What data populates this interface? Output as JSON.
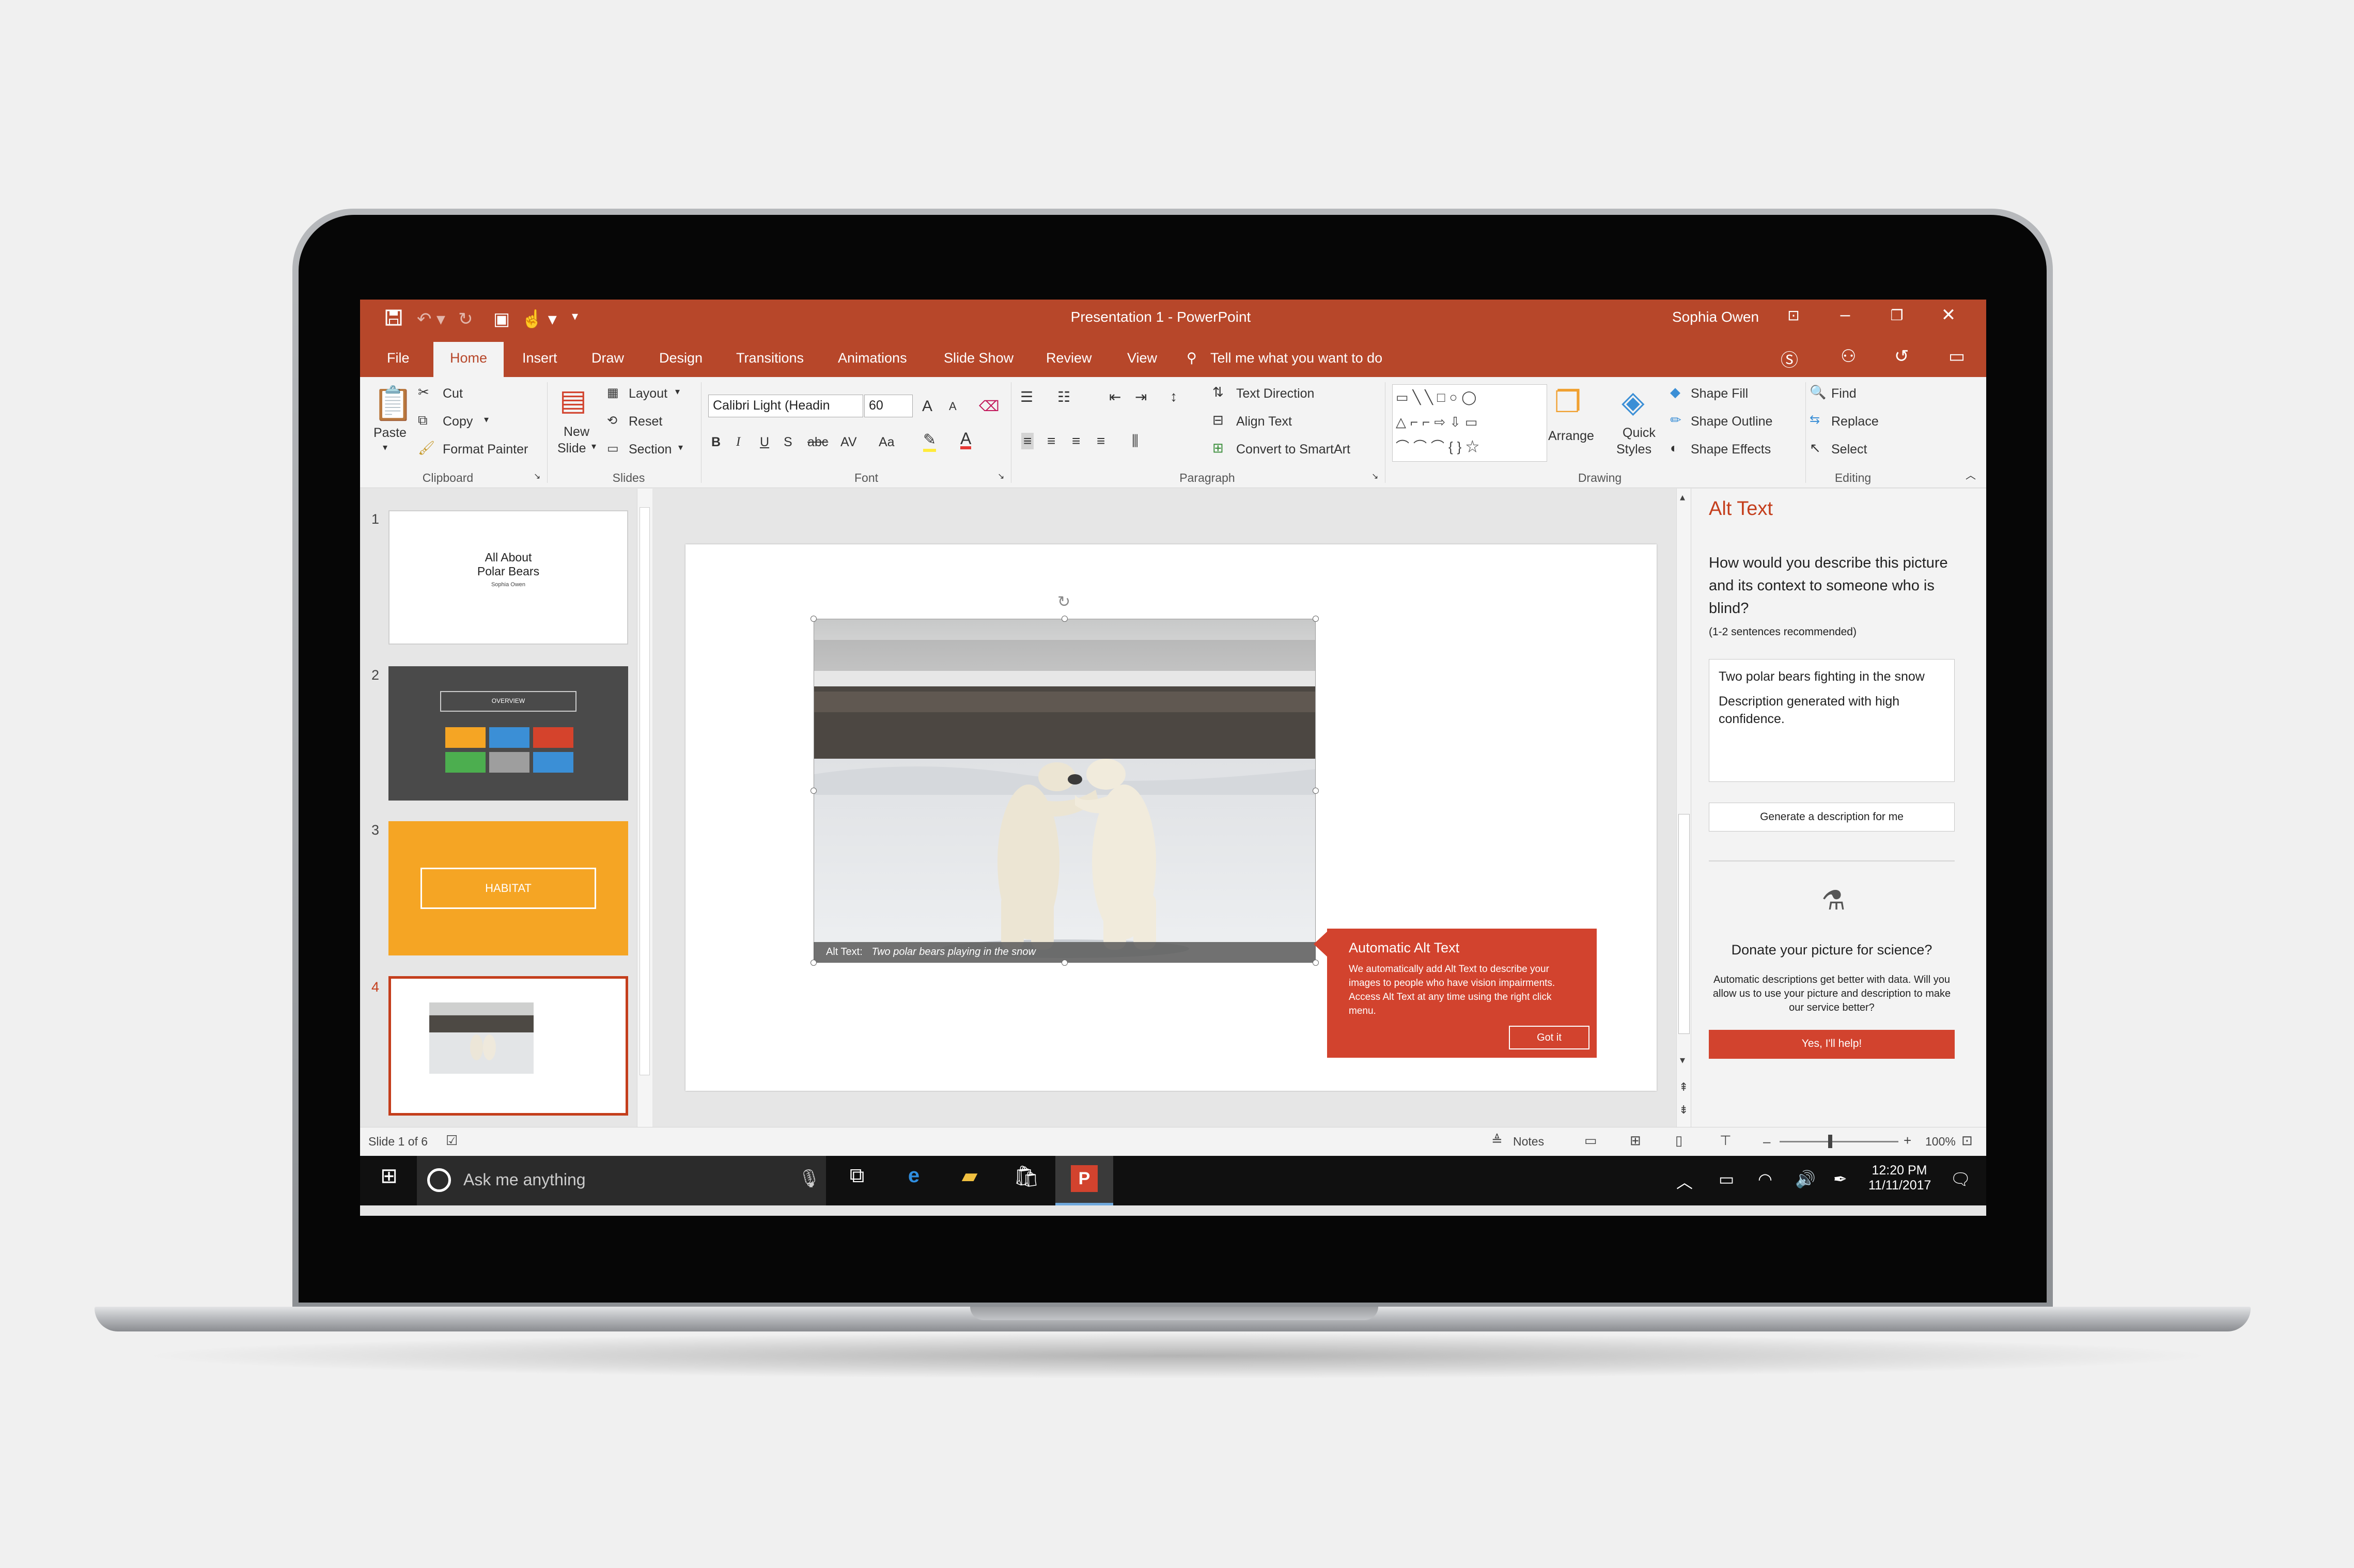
{
  "window": {
    "title": "Presentation 1 - PowerPoint",
    "user": "Sophia Owen"
  },
  "qat": {
    "save_icon": "save-icon",
    "undo_icon": "undo-icon",
    "redo_icon": "redo-icon",
    "present_icon": "present-icon",
    "touch_icon": "touch-mode-icon"
  },
  "tabs": [
    "File",
    "Home",
    "Insert",
    "Draw",
    "Design",
    "Transitions",
    "Animations",
    "Slide Show",
    "Review",
    "View"
  ],
  "tell_me": "Tell me what you want to do",
  "ribbon": {
    "clipboard": {
      "paste": "Paste",
      "cut": "Cut",
      "copy": "Copy",
      "format_painter": "Format Painter",
      "group": "Clipboard"
    },
    "slides": {
      "new_slide": "New",
      "new_slide2": "Slide",
      "layout": "Layout",
      "reset": "Reset",
      "section": "Section",
      "group": "Slides"
    },
    "font": {
      "family": "Calibri Light (Headin",
      "size": "60",
      "group": "Font",
      "bold": "B",
      "italic": "I",
      "underline": "U",
      "shadow": "S",
      "strike": "abc",
      "spacing": "AV",
      "case": "Aa",
      "grow": "A",
      "shrink": "A"
    },
    "paragraph": {
      "text_direction": "Text Direction",
      "align_text": "Align Text",
      "smartart": "Convert to SmartArt",
      "group": "Paragraph"
    },
    "drawing": {
      "arrange": "Arrange",
      "quick_styles": "Quick",
      "quick_styles2": "Styles",
      "shape_fill": "Shape Fill",
      "shape_outline": "Shape Outline",
      "shape_effects": "Shape Effects",
      "group": "Drawing"
    },
    "editing": {
      "find": "Find",
      "replace": "Replace",
      "select": "Select",
      "group": "Editing"
    }
  },
  "thumbnails": {
    "numbers": [
      "1",
      "2",
      "3",
      "4"
    ],
    "slide1_title1": "All About",
    "slide1_title2": "Polar Bears",
    "slide1_author": "Sophia Owen",
    "slide2_title": "OVERVIEW",
    "slide3_title": "HABITAT",
    "slide2_colors": [
      "#f5a524",
      "#3b8fd6",
      "#d5432c",
      "#4cae4f",
      "#9e9e9e",
      "#3b8fd6"
    ]
  },
  "slide": {
    "alt_prefix": "Alt Text:",
    "alt_text": "Two polar bears playing in the snow",
    "callout_title": "Automatic Alt Text",
    "callout_body": "We automatically add Alt Text to describe your images to people who have vision impairments. Access Alt Text at any time using the right click menu.",
    "callout_button": "Got it"
  },
  "alt_pane": {
    "title": "Alt Text",
    "question": "How would you describe this picture and its context to someone who is blind?",
    "hint": "(1-2 sentences recommended)",
    "text1": "Two polar bears fighting in the snow",
    "text2": "Description generated with high confidence.",
    "generate": "Generate a description for me",
    "donate_title": "Donate your picture for science?",
    "donate_body": "Automatic descriptions get better with data. Will you allow us to use your picture and description to make our service better?",
    "donate_button": "Yes, I'll help!"
  },
  "status": {
    "slide_count": "Slide 1 of 6",
    "notes": "Notes",
    "zoom": "100%"
  },
  "taskbar": {
    "search": "Ask me anything",
    "time": "12:20 PM",
    "date": "11/11/2017"
  },
  "colors": {
    "accent": "#b7472a",
    "callout": "#d2432e",
    "habitat": "#f5a524",
    "dark_slide": "#4a4a4a"
  }
}
